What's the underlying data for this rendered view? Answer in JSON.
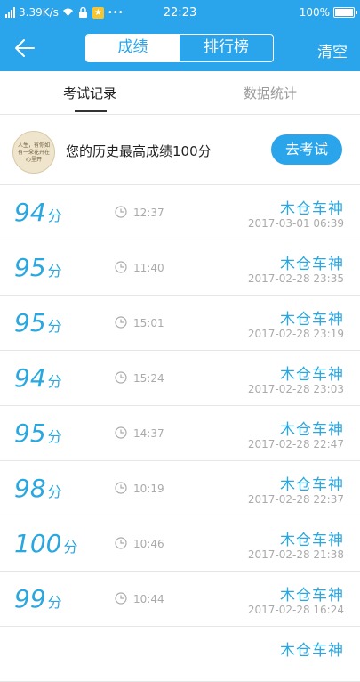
{
  "status_bar": {
    "speed": "3.39K/s",
    "time": "22:23",
    "battery": "100%"
  },
  "header": {
    "tabs": [
      "成绩",
      "排行榜"
    ],
    "clear_label": "清空"
  },
  "subtabs": [
    "考试记录",
    "数据统计"
  ],
  "best": {
    "avatar_text": "人生，有你如有一朵花开在心里开",
    "text": "您的历史最高成绩100分",
    "button_label": "去考试"
  },
  "score_unit": "分",
  "records": [
    {
      "score": "94",
      "duration": "12:37",
      "name": "木仓车神",
      "date": "2017-03-01 06:39"
    },
    {
      "score": "95",
      "duration": "11:40",
      "name": "木仓车神",
      "date": "2017-02-28 23:35"
    },
    {
      "score": "95",
      "duration": "15:01",
      "name": "木仓车神",
      "date": "2017-02-28 23:19"
    },
    {
      "score": "94",
      "duration": "15:24",
      "name": "木仓车神",
      "date": "2017-02-28 23:03"
    },
    {
      "score": "95",
      "duration": "14:37",
      "name": "木仓车神",
      "date": "2017-02-28 22:47"
    },
    {
      "score": "98",
      "duration": "10:19",
      "name": "木仓车神",
      "date": "2017-02-28 22:37"
    },
    {
      "score": "100",
      "duration": "10:46",
      "name": "木仓车神",
      "date": "2017-02-28 21:38"
    },
    {
      "score": "99",
      "duration": "10:44",
      "name": "木仓车神",
      "date": "2017-02-28 16:24"
    },
    {
      "score": "",
      "duration": "",
      "name": "木仓车神",
      "date": ""
    }
  ],
  "colors": {
    "accent": "#2aa4ea",
    "score": "#29a7e0",
    "muted": "#aaaaaa"
  }
}
